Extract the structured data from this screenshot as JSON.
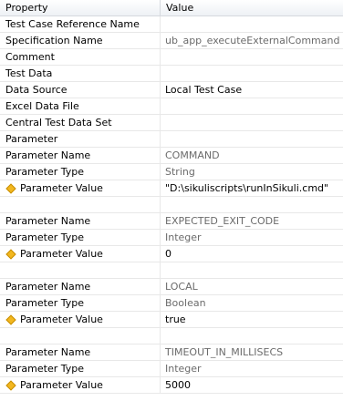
{
  "headers": {
    "property": "Property",
    "value": "Value"
  },
  "rows": [
    {
      "property": "Test Case Reference Name",
      "value": ""
    },
    {
      "property": "Specification Name",
      "value": "ub_app_executeExternalCommand"
    },
    {
      "property": "Comment",
      "value": ""
    },
    {
      "property": "Test Data",
      "value": ""
    },
    {
      "property": "Data Source",
      "value": "Local Test Case"
    },
    {
      "property": "Excel Data File",
      "value": ""
    },
    {
      "property": "Central Test Data Set",
      "value": ""
    },
    {
      "property": "Parameter",
      "value": ""
    },
    {
      "property": "Parameter Name",
      "value": "COMMAND"
    },
    {
      "property": "Parameter Type",
      "value": "String"
    },
    {
      "property": "Parameter Value",
      "value": "\"D:\\sikuliscripts\\runInSikuli.cmd\""
    },
    {
      "property": "",
      "value": ""
    },
    {
      "property": "Parameter Name",
      "value": "EXPECTED_EXIT_CODE"
    },
    {
      "property": "Parameter Type",
      "value": "Integer"
    },
    {
      "property": "Parameter Value",
      "value": "0"
    },
    {
      "property": "",
      "value": ""
    },
    {
      "property": "Parameter Name",
      "value": "LOCAL"
    },
    {
      "property": "Parameter Type",
      "value": "Boolean"
    },
    {
      "property": "Parameter Value",
      "value": "true"
    },
    {
      "property": "",
      "value": ""
    },
    {
      "property": "Parameter Name",
      "value": "TIMEOUT_IN_MILLISECS"
    },
    {
      "property": "Parameter Type",
      "value": "Integer"
    },
    {
      "property": "Parameter Value",
      "value": "5000"
    }
  ],
  "icons": {
    "parameter_value_marker": "yellow-diamond-icon"
  },
  "colors": {
    "marker": "#f2b71f",
    "muted_text": "#6b6b6b",
    "header_bg": "#eef1f5"
  }
}
